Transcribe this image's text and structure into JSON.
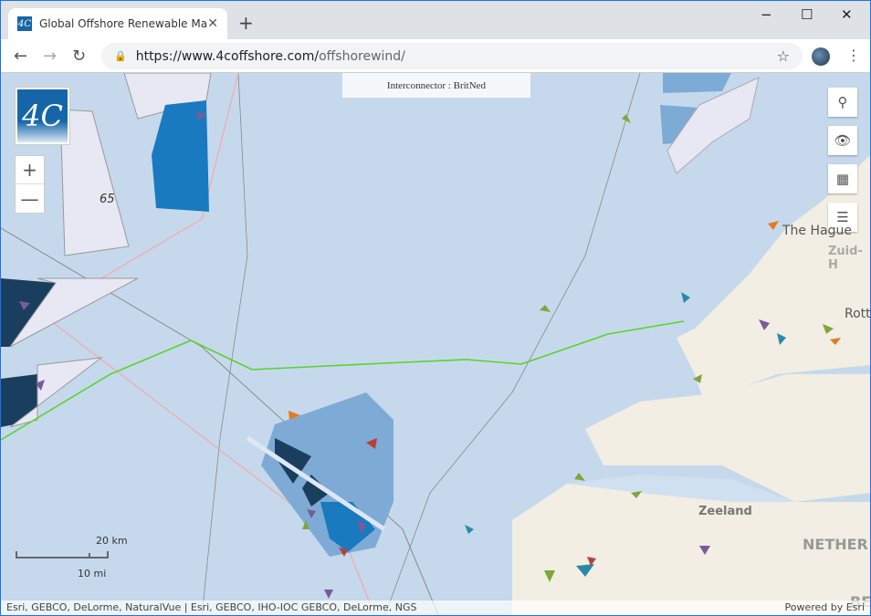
{
  "browser": {
    "tab_title": "Global Offshore Renewable Map",
    "favicon": "4C",
    "new_tab": "+",
    "url_host": "https://www.4coffshore.com/",
    "url_path": "offshorewind/",
    "minimize": "−",
    "maximize": "☐",
    "close": "✕"
  },
  "map": {
    "tooltip": "Interconnector : BritNed",
    "logo": "4C",
    "zoom_in": "+",
    "zoom_out": "—",
    "controls": [
      "search-icon",
      "eye-icon",
      "qr-grid-icon",
      "list-icon"
    ],
    "labels": {
      "site_number": "65",
      "the_hague": "The Hague",
      "zuid_holland": "Zuid-H",
      "rotterdam": "Rott",
      "zeeland": "Zeeland",
      "netherlands": "NETHER",
      "belgium": "BE"
    },
    "scale": {
      "km": "20 km",
      "mi": "10 mi"
    },
    "attribution": "Esri, GEBCO, DeLorme, NaturalVue | Esri, GEBCO, IHO-IOC GEBCO, DeLorme, NGS",
    "powered_by": "Powered by Esri",
    "colors": {
      "interconnector": "#5ad22a",
      "farm_dark": "#1a3f5e",
      "farm_mid": "#1a7abf",
      "farm_light": "#7eaad6",
      "farm_pale": "#e8e8f4",
      "land": "#f2eee3"
    }
  }
}
